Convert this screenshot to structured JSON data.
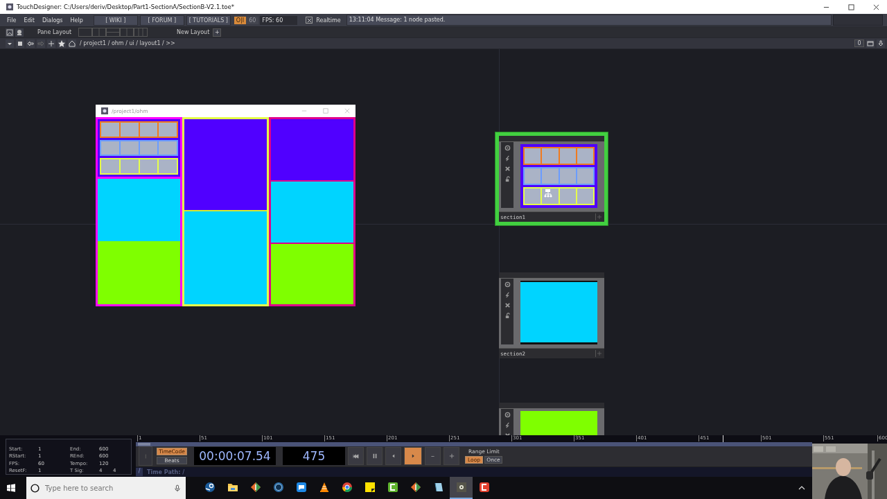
{
  "window": {
    "title": "TouchDesigner: C:/Users/deriv/Desktop/Part1-SectionA/SectionB-V2.1.toe*"
  },
  "menu": {
    "items": [
      "File",
      "Edit",
      "Dialogs",
      "Help"
    ],
    "links": [
      "[ WIKI ]",
      "[ FORUM ]",
      "[ TUTORIALS ]"
    ],
    "oi_badge": "O|I",
    "fps_cap": "60",
    "fps": "FPS:  60",
    "realtime": {
      "label": "Realtime",
      "checked": true
    },
    "message": "13:11:04 Message: 1 node pasted."
  },
  "pane_bar": {
    "pane_layout": "Pane Layout",
    "new_layout": "New Layout",
    "add": "+"
  },
  "path_bar": {
    "path": "/ project1 / ohm / ui / layout1 / >>",
    "counter": "0"
  },
  "floating_window": {
    "title": "/project1/ohm"
  },
  "nodes": [
    {
      "label": "section1",
      "selected": true,
      "kind": "grid"
    },
    {
      "label": "section2",
      "selected": false,
      "kind": "cyan"
    },
    {
      "selected": false,
      "kind": "green"
    }
  ],
  "timeline": {
    "ticks": [
      "1",
      "51",
      "101",
      "151",
      "201",
      "251",
      "301",
      "351",
      "401",
      "451",
      "501",
      "551",
      "600"
    ],
    "level": 0.79
  },
  "range_info": [
    {
      "label": "Start:",
      "value": "1"
    },
    {
      "label": "End:",
      "value": "600"
    },
    {
      "label": "RStart:",
      "value": "1"
    },
    {
      "label": "REnd:",
      "value": "600"
    },
    {
      "label": "FPS:",
      "value": "60"
    },
    {
      "label": "Tempo:",
      "value": "120"
    },
    {
      "label": "ResetF:",
      "value": "1"
    },
    {
      "label": "T Sig:",
      "value": "4",
      "value_2": "4"
    }
  ],
  "transport": {
    "modes": [
      {
        "label": "TimeCode",
        "selected": true
      },
      {
        "label": "Beats",
        "selected": false
      }
    ],
    "timecode": "00:00:07.54",
    "frame": "475",
    "play_on": true,
    "range_label": "Range Limit",
    "range_modes": [
      {
        "label": "Loop",
        "selected": true
      },
      {
        "label": "Once",
        "selected": false
      }
    ],
    "root": "/",
    "time_path": "Time Path: /"
  },
  "taskbar": {
    "search": {
      "placeholder": "Type here to search"
    },
    "apps": [
      {
        "kind": "round",
        "selected": false
      },
      {
        "kind": "folder",
        "selected": false
      },
      {
        "kind": "diamond",
        "selected": false
      },
      {
        "kind": "porthole",
        "selected": false
      },
      {
        "kind": "bubble",
        "selected": false
      },
      {
        "kind": "cone",
        "selected": false
      },
      {
        "kind": "browser",
        "selected": false
      },
      {
        "kind": "note",
        "selected": false
      },
      {
        "kind": "bracket",
        "selected": false
      },
      {
        "kind": "diamond",
        "selected": false
      },
      {
        "kind": "notebook",
        "selected": false
      },
      {
        "kind": "touch",
        "selected": true
      },
      {
        "kind": "bracket2",
        "selected": false
      }
    ]
  }
}
